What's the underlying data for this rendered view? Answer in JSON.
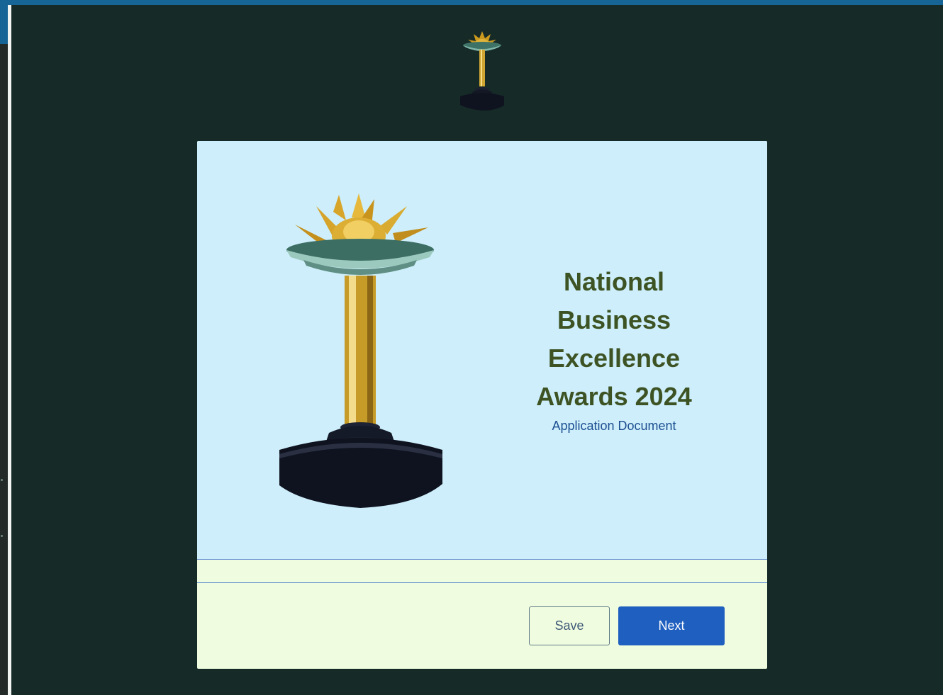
{
  "header": {
    "logo_icon": "trophy-logo-icon"
  },
  "hero": {
    "image_icon": "trophy-image",
    "title": "National Business Excellence Awards 2024",
    "subtitle": "Application Document"
  },
  "actions": {
    "save_label": "Save",
    "next_label": "Next"
  },
  "colors": {
    "background": "#162a27",
    "hero_background": "#cdeefa",
    "card_background": "#effcdf",
    "title": "#3d5324",
    "subtitle": "#1d4f92",
    "primary": "#1f5fbf"
  }
}
